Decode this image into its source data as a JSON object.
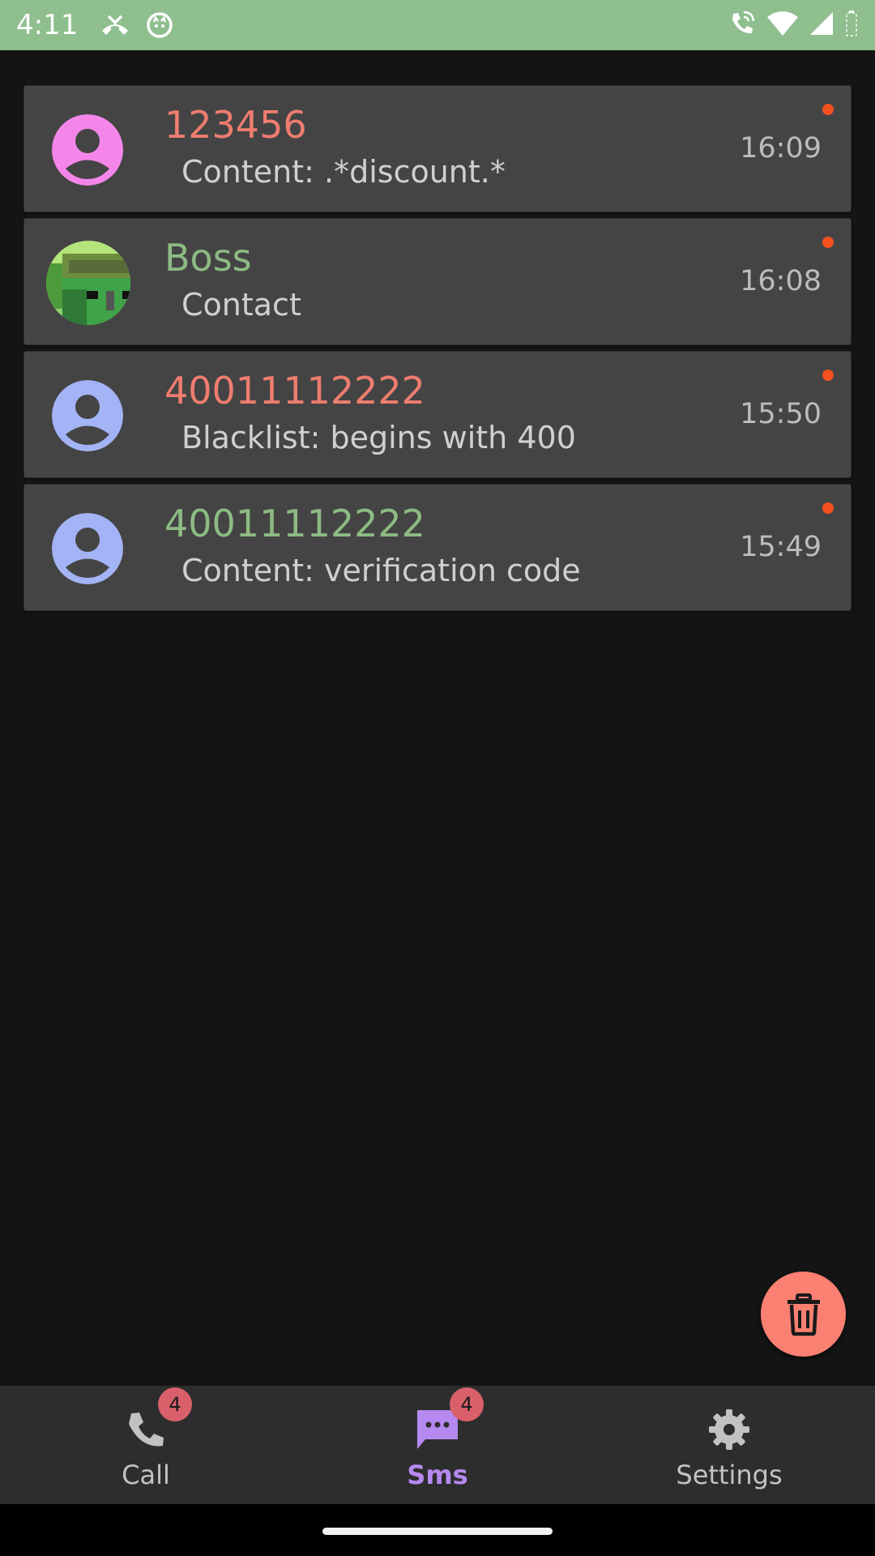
{
  "status_bar": {
    "time": "4:11",
    "icons_left": [
      "missed-call-icon",
      "cat-notification-icon"
    ],
    "icons_right": [
      "wifi-calling-icon",
      "wifi-icon",
      "cell-signal-icon",
      "battery-icon"
    ]
  },
  "sms_list": {
    "items": [
      {
        "sender": "123456",
        "sender_color": "#ef7d70",
        "reason": "Content: .*discount.*",
        "time": "16:09",
        "avatar": "person-avatar",
        "avatar_color": "#f486e9",
        "unread": true
      },
      {
        "sender": "Boss",
        "sender_color": "#8dbb83",
        "reason": "Contact",
        "time": "16:08",
        "avatar": "contact-photo",
        "unread": true
      },
      {
        "sender": "40011112222",
        "sender_color": "#ef7d70",
        "reason": "Blacklist: begins with 400",
        "time": "15:50",
        "avatar": "person-avatar",
        "avatar_color": "#a3b3f5",
        "unread": true
      },
      {
        "sender": "40011112222",
        "sender_color": "#8dbb83",
        "reason": "Content: verification code",
        "time": "15:49",
        "avatar": "person-avatar",
        "avatar_color": "#a3b3f5",
        "unread": true
      }
    ]
  },
  "fab": {
    "icon": "trash-icon",
    "color": "#fa8072"
  },
  "bottom_nav": {
    "items": [
      {
        "label": "Call",
        "icon": "phone-icon",
        "badge": "4",
        "active": false
      },
      {
        "label": "Sms",
        "icon": "message-icon",
        "badge": "4",
        "active": true
      },
      {
        "label": "Settings",
        "icon": "gear-icon",
        "badge": "",
        "active": false
      }
    ],
    "active_color": "#b589f0",
    "badge_color": "#d9606a"
  }
}
